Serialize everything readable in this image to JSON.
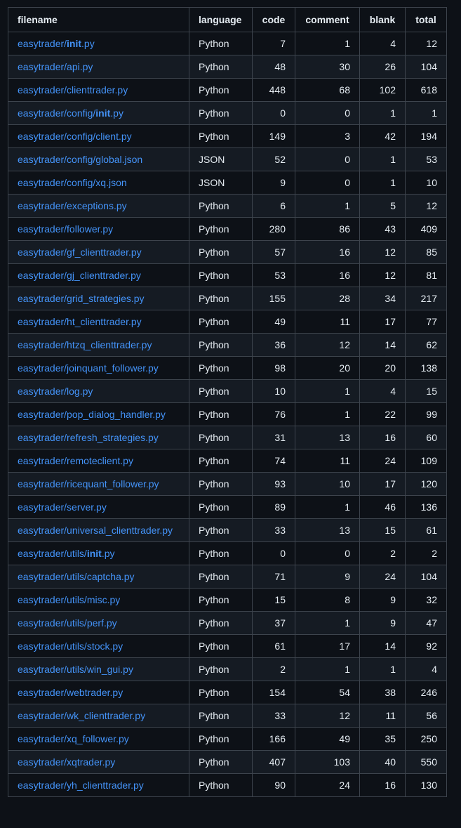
{
  "table": {
    "headers": {
      "filename": "filename",
      "language": "language",
      "code": "code",
      "comment": "comment",
      "blank": "blank",
      "total": "total"
    },
    "rows": [
      {
        "filename": "easytrader/init.py",
        "language": "Python",
        "code": "7",
        "comment": "1",
        "blank": "4",
        "total": "12"
      },
      {
        "filename": "easytrader/api.py",
        "language": "Python",
        "code": "48",
        "comment": "30",
        "blank": "26",
        "total": "104"
      },
      {
        "filename": "easytrader/clienttrader.py",
        "language": "Python",
        "code": "448",
        "comment": "68",
        "blank": "102",
        "total": "618"
      },
      {
        "filename": "easytrader/config/init.py",
        "language": "Python",
        "code": "0",
        "comment": "0",
        "blank": "1",
        "total": "1"
      },
      {
        "filename": "easytrader/config/client.py",
        "language": "Python",
        "code": "149",
        "comment": "3",
        "blank": "42",
        "total": "194"
      },
      {
        "filename": "easytrader/config/global.json",
        "language": "JSON",
        "code": "52",
        "comment": "0",
        "blank": "1",
        "total": "53"
      },
      {
        "filename": "easytrader/config/xq.json",
        "language": "JSON",
        "code": "9",
        "comment": "0",
        "blank": "1",
        "total": "10"
      },
      {
        "filename": "easytrader/exceptions.py",
        "language": "Python",
        "code": "6",
        "comment": "1",
        "blank": "5",
        "total": "12"
      },
      {
        "filename": "easytrader/follower.py",
        "language": "Python",
        "code": "280",
        "comment": "86",
        "blank": "43",
        "total": "409"
      },
      {
        "filename": "easytrader/gf_clienttrader.py",
        "language": "Python",
        "code": "57",
        "comment": "16",
        "blank": "12",
        "total": "85"
      },
      {
        "filename": "easytrader/gj_clienttrader.py",
        "language": "Python",
        "code": "53",
        "comment": "16",
        "blank": "12",
        "total": "81"
      },
      {
        "filename": "easytrader/grid_strategies.py",
        "language": "Python",
        "code": "155",
        "comment": "28",
        "blank": "34",
        "total": "217"
      },
      {
        "filename": "easytrader/ht_clienttrader.py",
        "language": "Python",
        "code": "49",
        "comment": "11",
        "blank": "17",
        "total": "77"
      },
      {
        "filename": "easytrader/htzq_clienttrader.py",
        "language": "Python",
        "code": "36",
        "comment": "12",
        "blank": "14",
        "total": "62"
      },
      {
        "filename": "easytrader/joinquant_follower.py",
        "language": "Python",
        "code": "98",
        "comment": "20",
        "blank": "20",
        "total": "138"
      },
      {
        "filename": "easytrader/log.py",
        "language": "Python",
        "code": "10",
        "comment": "1",
        "blank": "4",
        "total": "15"
      },
      {
        "filename": "easytrader/pop_dialog_handler.py",
        "language": "Python",
        "code": "76",
        "comment": "1",
        "blank": "22",
        "total": "99"
      },
      {
        "filename": "easytrader/refresh_strategies.py",
        "language": "Python",
        "code": "31",
        "comment": "13",
        "blank": "16",
        "total": "60"
      },
      {
        "filename": "easytrader/remoteclient.py",
        "language": "Python",
        "code": "74",
        "comment": "11",
        "blank": "24",
        "total": "109"
      },
      {
        "filename": "easytrader/ricequant_follower.py",
        "language": "Python",
        "code": "93",
        "comment": "10",
        "blank": "17",
        "total": "120"
      },
      {
        "filename": "easytrader/server.py",
        "language": "Python",
        "code": "89",
        "comment": "1",
        "blank": "46",
        "total": "136"
      },
      {
        "filename": "easytrader/universal_clienttrader.py",
        "language": "Python",
        "code": "33",
        "comment": "13",
        "blank": "15",
        "total": "61"
      },
      {
        "filename": "easytrader/utils/init.py",
        "language": "Python",
        "code": "0",
        "comment": "0",
        "blank": "2",
        "total": "2"
      },
      {
        "filename": "easytrader/utils/captcha.py",
        "language": "Python",
        "code": "71",
        "comment": "9",
        "blank": "24",
        "total": "104"
      },
      {
        "filename": "easytrader/utils/misc.py",
        "language": "Python",
        "code": "15",
        "comment": "8",
        "blank": "9",
        "total": "32"
      },
      {
        "filename": "easytrader/utils/perf.py",
        "language": "Python",
        "code": "37",
        "comment": "1",
        "blank": "9",
        "total": "47"
      },
      {
        "filename": "easytrader/utils/stock.py",
        "language": "Python",
        "code": "61",
        "comment": "17",
        "blank": "14",
        "total": "92"
      },
      {
        "filename": "easytrader/utils/win_gui.py",
        "language": "Python",
        "code": "2",
        "comment": "1",
        "blank": "1",
        "total": "4"
      },
      {
        "filename": "easytrader/webtrader.py",
        "language": "Python",
        "code": "154",
        "comment": "54",
        "blank": "38",
        "total": "246"
      },
      {
        "filename": "easytrader/wk_clienttrader.py",
        "language": "Python",
        "code": "33",
        "comment": "12",
        "blank": "11",
        "total": "56"
      },
      {
        "filename": "easytrader/xq_follower.py",
        "language": "Python",
        "code": "166",
        "comment": "49",
        "blank": "35",
        "total": "250"
      },
      {
        "filename": "easytrader/xqtrader.py",
        "language": "Python",
        "code": "407",
        "comment": "103",
        "blank": "40",
        "total": "550"
      },
      {
        "filename": "easytrader/yh_clienttrader.py",
        "language": "Python",
        "code": "90",
        "comment": "24",
        "blank": "16",
        "total": "130"
      }
    ]
  },
  "colors": {
    "background": "#0d1117",
    "row_alt": "#151b23",
    "border": "#3d444d",
    "text": "#e6edf3",
    "link": "#4493f8"
  }
}
